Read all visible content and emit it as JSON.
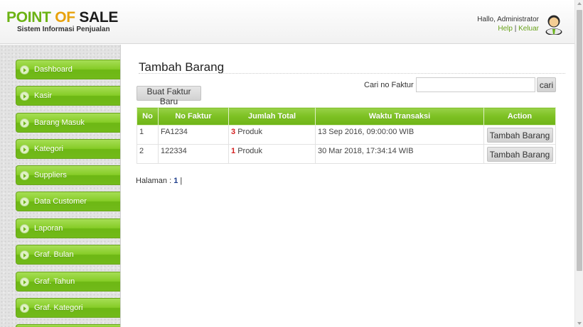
{
  "header": {
    "logo_word1": "POINT",
    "logo_word2": "OF",
    "logo_word3": "SALE",
    "subtitle": "Sistem Informasi Penjualan",
    "greeting": "Hallo, Administrator",
    "help_link": "Help",
    "separator": "|",
    "logout_link": "Keluar"
  },
  "sidebar": {
    "items": [
      {
        "label": "Dashboard"
      },
      {
        "label": "Kasir"
      },
      {
        "label": "Barang Masuk"
      },
      {
        "label": "Kategori"
      },
      {
        "label": "Suppliers"
      },
      {
        "label": "Data Customer"
      },
      {
        "label": "Laporan"
      },
      {
        "label": "Graf. Bulan"
      },
      {
        "label": "Graf. Tahun"
      },
      {
        "label": "Graf. Kategori"
      }
    ]
  },
  "main": {
    "title": "Tambah Barang",
    "new_invoice_button": "Buat Faktur Baru",
    "search_label": "Cari no Faktur :",
    "search_value": "",
    "search_placeholder": "",
    "search_button": "cari",
    "table": {
      "headers": [
        "No",
        "No Faktur",
        "Jumlah Total",
        "Waktu Transaksi",
        "Action"
      ],
      "rows": [
        {
          "no": "1",
          "faktur": "FA1234",
          "qty": "3",
          "unit": "Produk",
          "time": "13 Sep 2016, 09:00:00 WIB",
          "action": "Tambah Barang"
        },
        {
          "no": "2",
          "faktur": "122334",
          "qty": "1",
          "unit": "Produk",
          "time": "30 Mar 2018, 17:34:14 WIB",
          "action": "Tambah Barang"
        }
      ]
    },
    "pagination": {
      "label": "Halaman :",
      "current": "1",
      "separator": "|"
    }
  },
  "colors": {
    "accent_green": "#7cc022",
    "logo_orange": "#e8a20c",
    "quantity_red": "#d42020"
  },
  "icons": {
    "user": "user-avatar-icon",
    "menu_bullet": "chevron-right-icon"
  }
}
